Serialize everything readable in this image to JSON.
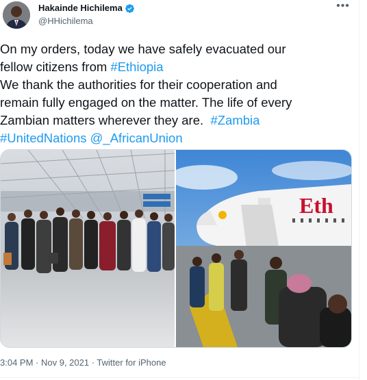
{
  "author": {
    "display_name": "Hakainde Hichilema",
    "handle": "@HHichilema"
  },
  "tweet": {
    "line1_text": "On my orders, today we have safely evacuated our",
    "line2_text": "fellow citizens from ",
    "hashtag_ethiopia": "#Ethiopia",
    "line3_text": "We thank the authorities for their cooperation and",
    "line4_text": "remain fully engaged on the matter. The life of every",
    "line5_text": "Zambian matters wherever they are.  ",
    "hashtag_zambia": "#Zambia",
    "hashtag_un": "#UnitedNations",
    "mention_au": "@_AfricanUnion"
  },
  "photo2_plane_text": "Eth",
  "meta": {
    "time": "3:04 PM",
    "separator": " · ",
    "date": "Nov 9, 2021",
    "source": "Twitter for iPhone"
  },
  "colors": {
    "link": "#1d9bf0",
    "text": "#0f1419",
    "secondary": "#536471",
    "verified": "#1d9bf0"
  },
  "icons": [
    "verified-badge-icon",
    "more-options-icon"
  ]
}
